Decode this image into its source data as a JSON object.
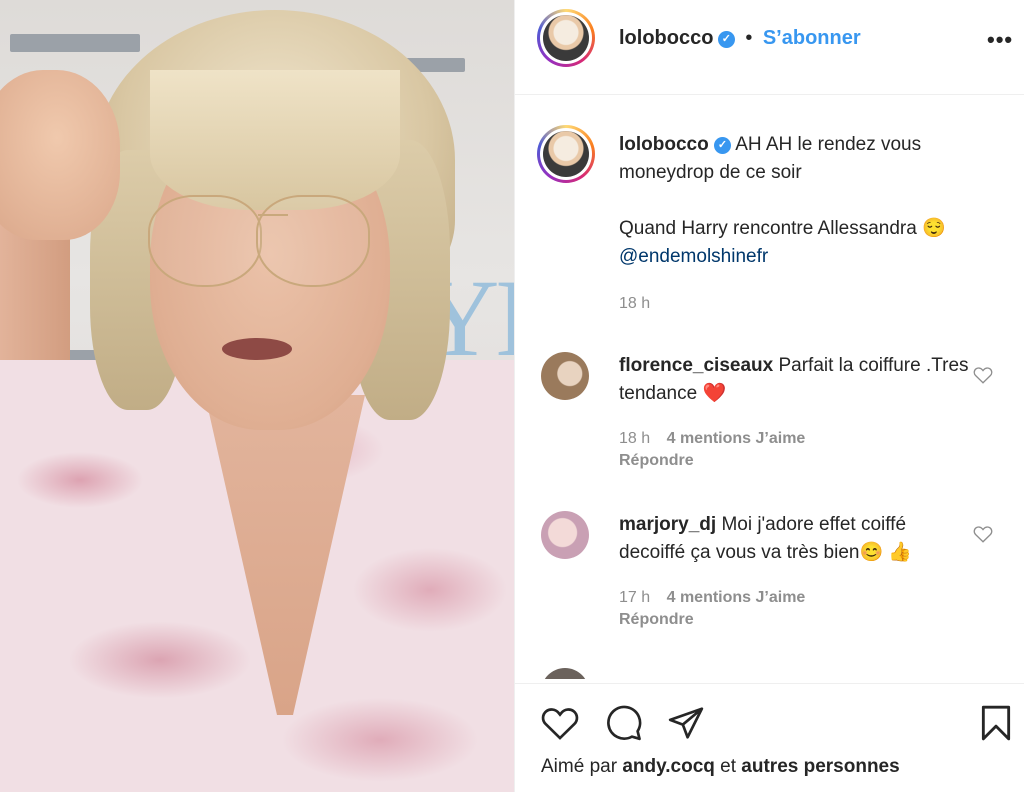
{
  "post": {
    "author": "lolobocco",
    "follow_label": "S’abonner",
    "separator": "•",
    "verified_mark": "✓",
    "more_label": "•••"
  },
  "caption": {
    "author": "lolobocco",
    "text_line1": "AH AH le rendez vous moneydrop de ce soir",
    "text_line2": "Quand Harry rencontre Allessandra 😌",
    "mention": "@endemolshinefr",
    "time": "18 h"
  },
  "comments": [
    {
      "author": "florence_ciseaux",
      "text": "Parfait la coiffure .Tres tendance ❤️",
      "time": "18 h",
      "likes": "4 mentions J’aime",
      "reply": "Répondre"
    },
    {
      "author": "marjory_dj",
      "text": "Moi j'adore effet coiffé decoiffé ça vous va très bien😊 👍",
      "time": "17 h",
      "likes": "4 mentions J’aime",
      "reply": "Répondre"
    }
  ],
  "footer": {
    "liked_by_prefix": "Aimé par",
    "liked_by_user": "andy.cocq",
    "liked_by_and": "et",
    "liked_by_others": "autres personnes"
  },
  "colors": {
    "link_blue": "#3897f0",
    "mention_blue": "#00376b",
    "muted": "#8e8e8e",
    "text": "#262626",
    "like_red": "#ed4956"
  },
  "icons": [
    "heart-icon",
    "comment-icon",
    "share-icon",
    "bookmark-icon",
    "verified-icon",
    "more-options-icon"
  ]
}
